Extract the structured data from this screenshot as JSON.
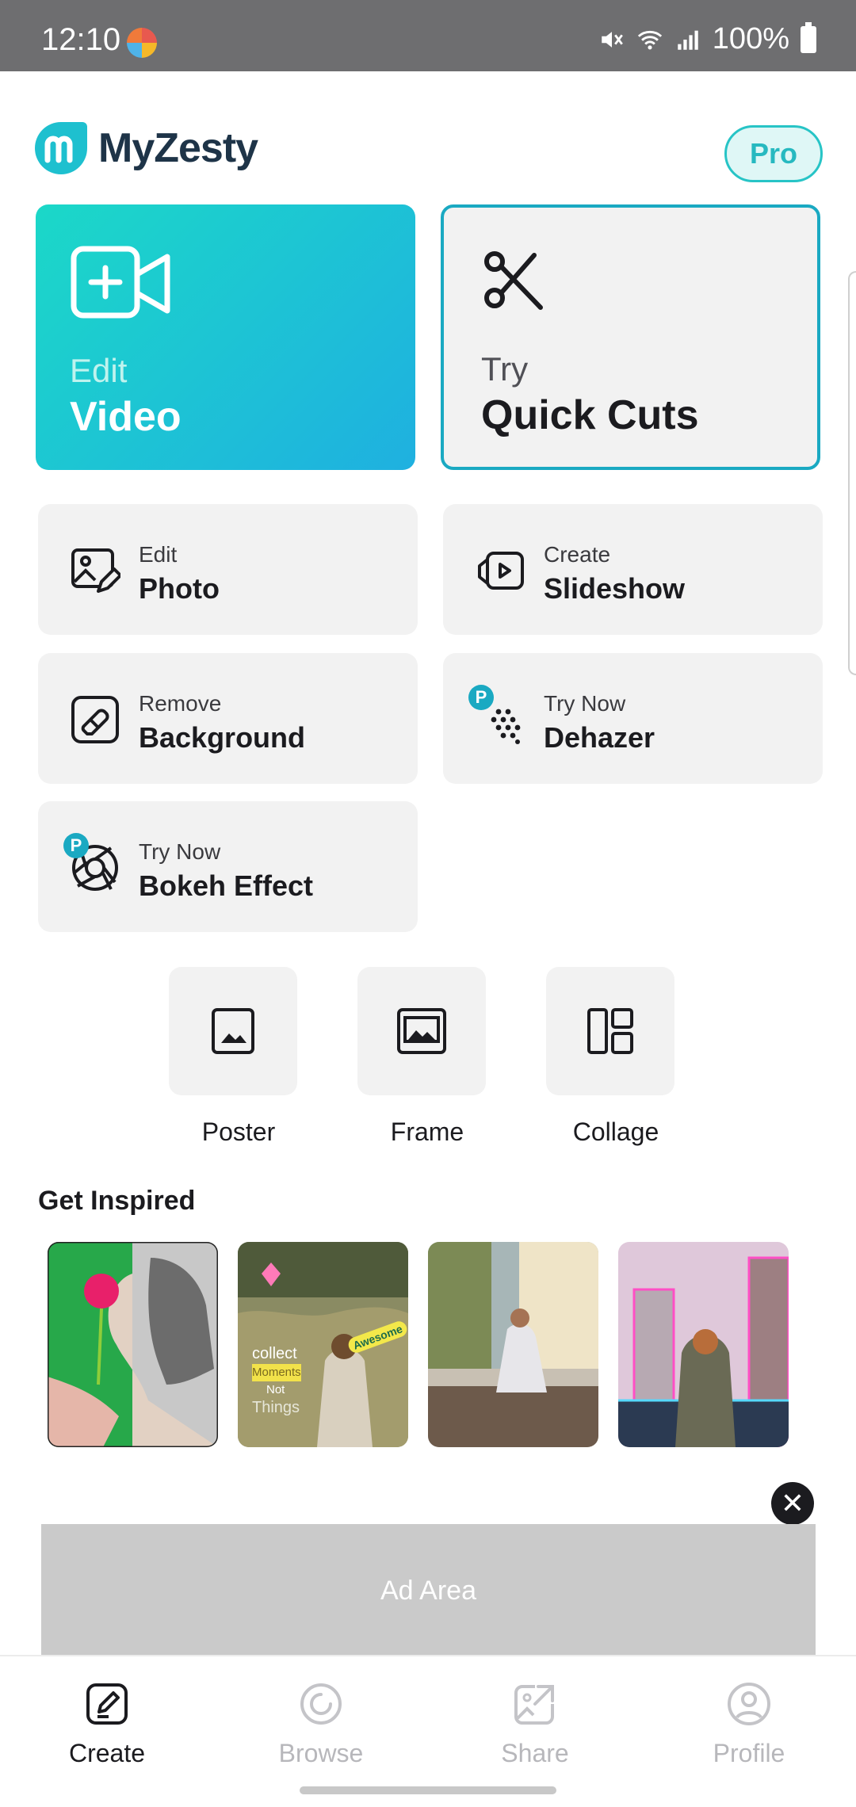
{
  "status_bar": {
    "time": "12:10",
    "battery": "100%"
  },
  "header": {
    "brand": "MyZesty",
    "pro_label": "Pro"
  },
  "cards": {
    "video": {
      "small": "Edit",
      "big": "Video"
    },
    "quick_cuts": {
      "small": "Try",
      "big": "Quick Cuts"
    }
  },
  "tiles": [
    {
      "small": "Edit",
      "big": "Photo",
      "icon": "photo-edit-icon"
    },
    {
      "small": "Create",
      "big": "Slideshow",
      "icon": "slideshow-icon"
    },
    {
      "small": "Remove",
      "big": "Background",
      "icon": "eraser-icon"
    },
    {
      "small": "Try Now",
      "big": "Dehazer",
      "icon": "dehazer-icon",
      "badge": "P"
    },
    {
      "small": "Try Now",
      "big": "Bokeh Effect",
      "icon": "aperture-icon",
      "badge": "P"
    }
  ],
  "tools": [
    {
      "label": "Poster",
      "icon": "poster-icon"
    },
    {
      "label": "Frame",
      "icon": "frame-icon"
    },
    {
      "label": "Collage",
      "icon": "collage-icon"
    }
  ],
  "inspired": {
    "title": "Get Inspired",
    "thumb2_text": [
      "collect",
      "Moments",
      "Not",
      "Things"
    ],
    "thumb2_sticker": "Awesome"
  },
  "ad": {
    "label": "Ad Area",
    "close": "✕"
  },
  "nav": [
    {
      "label": "Create",
      "icon": "create-pencil-icon",
      "active": true
    },
    {
      "label": "Browse",
      "icon": "browse-icon",
      "active": false
    },
    {
      "label": "Share",
      "icon": "share-icon",
      "active": false
    },
    {
      "label": "Profile",
      "icon": "profile-icon",
      "active": false
    }
  ],
  "colors": {
    "accent": "#1aa9c2",
    "teal": "#1bd8c8",
    "tile_bg": "#f2f2f2",
    "status_bar": "#6e6e70"
  }
}
